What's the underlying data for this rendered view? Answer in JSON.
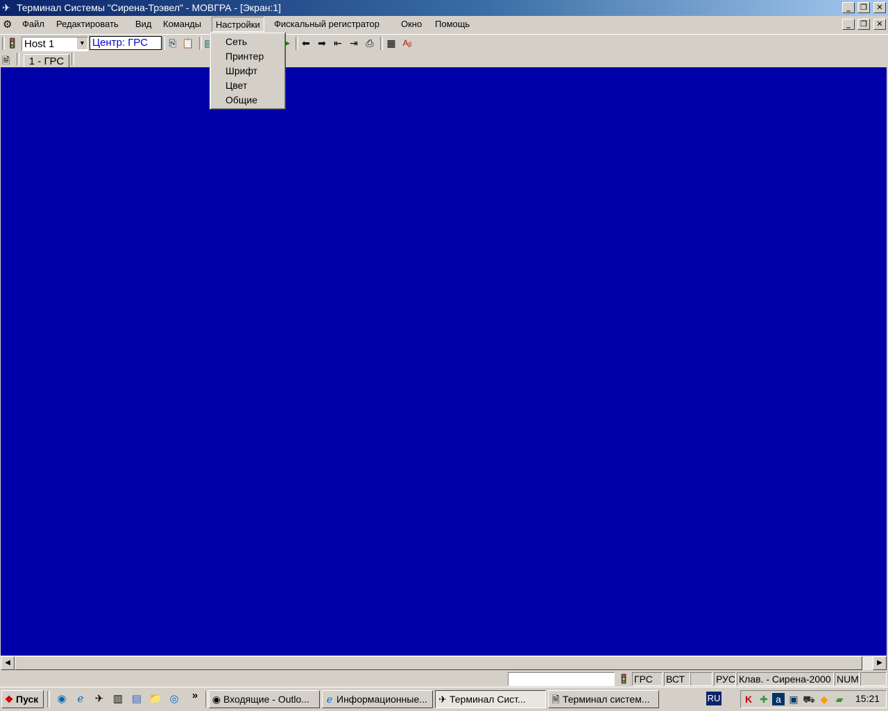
{
  "window": {
    "title": "Терминал Системы \"Сирена-Трэвел\" - МОВГРА - [Экран:1]",
    "minimize": "_",
    "restore": "❐",
    "close": "✕"
  },
  "menubar": {
    "items": [
      "Файл",
      "Редактировать",
      "Вид",
      "Команды",
      "Настройки",
      "Фискальный регистратор",
      "Окно",
      "Помощь"
    ],
    "open_item": "Настройки"
  },
  "dropdown": {
    "items": [
      "Сеть",
      "Принтер",
      "Шрифт",
      "Цвет",
      "Общие"
    ]
  },
  "toolbar": {
    "host_value": "Host 1",
    "center_label": "Центр: ГРС"
  },
  "tabs": {
    "items": [
      "1 - ГРС"
    ]
  },
  "statusbar": {
    "input_value": "",
    "panels": [
      "ГРС",
      "ВСТ",
      "",
      "РУС",
      "Клав. - Сирена-2000",
      "NUM",
      ""
    ]
  },
  "taskbar": {
    "start_label": "Пуск",
    "quicklaunch_more": "»",
    "tasks": [
      "Входящие - Outlo...",
      "Информационные...",
      "Терминал Сист...",
      "Терминал систем..."
    ],
    "active_task_index": 2,
    "language": "RU",
    "clock": "15:21"
  },
  "colors": {
    "terminal_background": "#0000a8",
    "titlebar_start": "#0a246a",
    "titlebar_end": "#a6caf0",
    "center_text": "#0000cc"
  }
}
